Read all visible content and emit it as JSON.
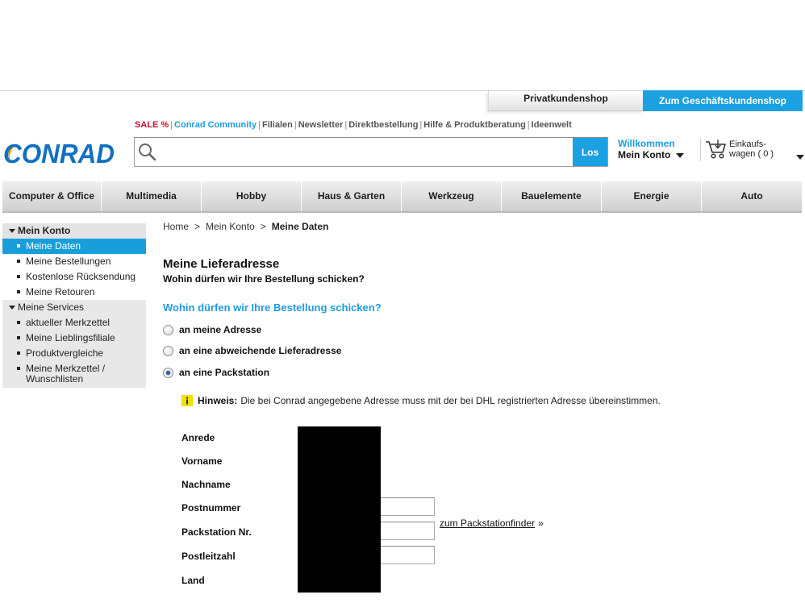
{
  "top_tabs": {
    "private": "Privatkundenshop",
    "business": "Zum Geschäftskundenshop"
  },
  "top_links": {
    "sale": "SALE %",
    "community": "Conrad Community",
    "items": [
      "Filialen",
      "Newsletter",
      "Direktbestellung",
      "Hilfe & Produktberatung",
      "Ideenwelt"
    ],
    "separator": "|"
  },
  "header": {
    "logo_text": "CONRAD",
    "search_button": "Los",
    "welcome": "Willkommen",
    "account": "Mein Konto",
    "cart_line1": "Einkaufs-",
    "cart_line2": "wagen ( 0 )"
  },
  "nav": [
    "Computer & Office",
    "Multimedia",
    "Hobby",
    "Haus & Garten",
    "Werkzeug",
    "Bauelemente",
    "Energie",
    "Auto"
  ],
  "sidebar": {
    "sections": [
      {
        "title": "Mein Konto",
        "active_index": 0,
        "items": [
          "Meine Daten",
          "Meine Bestellungen",
          "Kostenlose Rücksendung",
          "Meine Retouren"
        ]
      },
      {
        "title": "Meine Services",
        "items": [
          "aktueller Merkzettel",
          "Meine Lieblingsfiliale",
          "Produktvergleiche",
          "Meine Merkzettel / Wunschlisten"
        ]
      }
    ]
  },
  "breadcrumb": {
    "items": [
      "Home",
      "Mein Konto",
      "Meine Daten"
    ],
    "separator": ">"
  },
  "main": {
    "title": "Meine Lieferadresse",
    "subtitle": "Wohin dürfen wir Ihre Bestellung schicken?",
    "question": "Wohin dürfen wir Ihre Bestellung schicken?",
    "options": [
      {
        "label": "an meine Adresse",
        "checked": false
      },
      {
        "label": "an eine abweichende Lieferadresse",
        "checked": false
      },
      {
        "label": "an eine Packstation",
        "checked": true
      }
    ],
    "hint_label": "Hinweis:",
    "hint_text": "Die bei Conrad angegebene Adresse muss mit der bei DHL registrierten Adresse übereinstimmen.",
    "form_labels": [
      "Anrede",
      "Vorname",
      "Nachname",
      "Postnummer",
      "Packstation Nr.",
      "Postleitzahl",
      "Land"
    ],
    "packstation_link": "zum Packstationfinder",
    "packstation_link_suffix": "»"
  },
  "icons": {
    "search": "search-icon",
    "cart": "cart-icon",
    "dropdown": "chevron-down-icon",
    "info": "info-icon",
    "section_toggle": "triangle-down-icon",
    "list_bullet": "square-bullet-icon"
  },
  "colors": {
    "brand_blue": "#1ba1e2",
    "logo_blue": "#1170c0",
    "logo_orange": "#f39200",
    "sale_red": "#c8102e",
    "hint_yellow": "#f2e100"
  }
}
